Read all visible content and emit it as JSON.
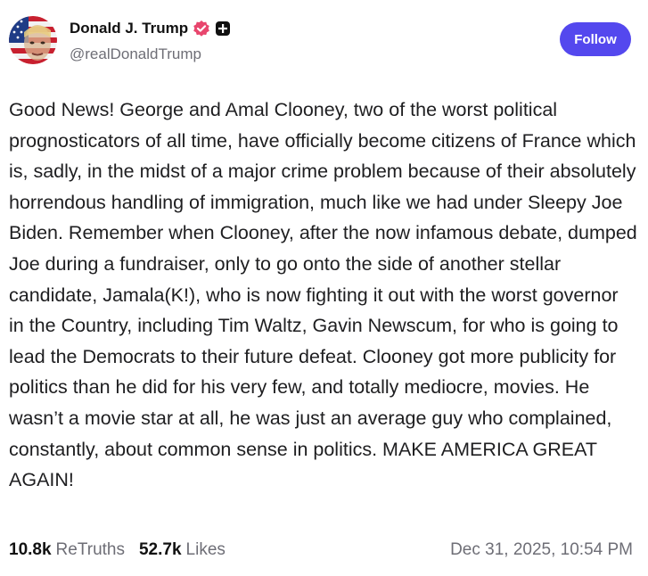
{
  "author": {
    "name": "Donald J. Trump",
    "handle": "@realDonaldTrump"
  },
  "follow_label": "Follow",
  "post": {
    "text": "Good News! George and Amal Clooney, two of the worst political prognosticators of all time, have officially become citizens of France which is, sadly, in the midst of a major crime problem because of their absolutely horrendous handling of immigration, much like we had under Sleepy Joe Biden. Remember when Clooney, after the now infamous debate, dumped Joe during a fundraiser, only to go onto the side of another stellar candidate, Jamala(K!), who is now fighting it out with the worst governor in the Country, including Tim Waltz, Gavin Newscum, for who is going to lead the Democrats to their future defeat. Clooney got more publicity for politics than he did for his very few, and totally mediocre, movies. He wasn’t a movie star at all, he was just an average guy who complained, constantly, about common sense in politics. MAKE AMERICA GREAT AGAIN!"
  },
  "stats": {
    "retruths_count": "10.8k",
    "retruths_label": "ReTruths",
    "likes_count": "52.7k",
    "likes_label": "Likes"
  },
  "timestamp": "Dec 31, 2025, 10:54 PM",
  "colors": {
    "accent": "#5448ee",
    "verified": "#e8466d",
    "muted": "#6e6e76"
  },
  "icons": {
    "verified": "verified-badge-icon",
    "plus": "plus-badge-icon"
  }
}
